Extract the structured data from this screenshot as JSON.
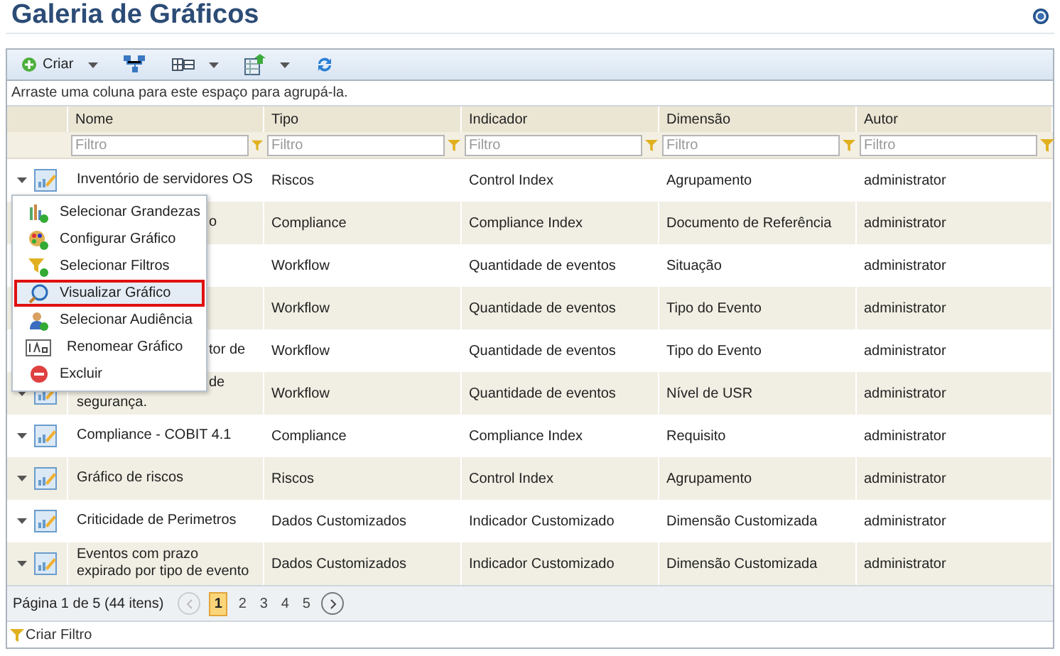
{
  "page": {
    "title": "Galeria de Gráficos"
  },
  "toolbar": [
    {
      "kind": "create",
      "label": "Criar",
      "dropdown": true
    },
    {
      "kind": "hierarchy",
      "dropdown": false
    },
    {
      "kind": "columns",
      "dropdown": true
    },
    {
      "kind": "export",
      "dropdown": true
    },
    {
      "kind": "refresh",
      "dropdown": false
    }
  ],
  "group_panel": {
    "text": "Arraste uma coluna para este espaço para agrupá-la."
  },
  "table": {
    "columns": [
      {
        "label": "Nome",
        "filter_placeholder": "Filtro"
      },
      {
        "label": "Tipo",
        "filter_placeholder": "Filtro"
      },
      {
        "label": "Indicador",
        "filter_placeholder": "Filtro"
      },
      {
        "label": "Dimensão",
        "filter_placeholder": "Filtro"
      },
      {
        "label": "Autor",
        "filter_placeholder": "Filtro"
      }
    ],
    "rows": [
      {
        "kind": "normal",
        "cells": [
          "Inventório de servidores OS",
          "Riscos",
          "Control Index",
          "Agrupamento",
          "administrator"
        ]
      },
      {
        "kind": "under_menu",
        "cells": [
          "o",
          "Compliance",
          "Compliance Index",
          "Documento de Referência",
          "administrator"
        ]
      },
      {
        "kind": "under_menu",
        "cells": [
          "",
          "Workflow",
          "Quantidade de eventos",
          "Situação",
          "administrator"
        ]
      },
      {
        "kind": "under_menu",
        "cells": [
          "",
          "Workflow",
          "Quantidade de eventos",
          "Tipo do Evento",
          "administrator"
        ]
      },
      {
        "kind": "under_menu",
        "cells": [
          "tor de",
          "Workflow",
          "Quantidade de eventos",
          "Tipo do Evento",
          "administrator"
        ]
      },
      {
        "kind": "partly_under_menu",
        "cells": [
          "de\nsegurança.",
          "Workflow",
          "Quantidade de eventos",
          "Nível de USR",
          "administrator"
        ]
      },
      {
        "kind": "normal",
        "cells": [
          "Compliance - COBIT 4.1",
          "Compliance",
          "Compliance Index",
          "Requisito",
          "administrator"
        ]
      },
      {
        "kind": "normal",
        "cells": [
          "Gráfico de riscos",
          "Riscos",
          "Control Index",
          "Agrupamento",
          "administrator"
        ]
      },
      {
        "kind": "normal",
        "cells": [
          "Criticidade de Perimetros",
          "Dados Customizados",
          "Indicador Customizado",
          "Dimensão Customizada",
          "administrator"
        ]
      },
      {
        "kind": "normal",
        "cells": [
          "Eventos com prazo expirado por tipo de evento",
          "Dados Customizados",
          "Indicador Customizado",
          "Dimensão Customizada",
          "administrator"
        ]
      }
    ]
  },
  "context_menu": {
    "items": [
      {
        "kind": "measures",
        "label": "Selecionar Grandezas",
        "selected": false
      },
      {
        "kind": "configure",
        "label": "Configurar Gráfico",
        "selected": false
      },
      {
        "kind": "filters",
        "label": "Selecionar Filtros",
        "selected": false
      },
      {
        "kind": "view",
        "label": "Visualizar Gráfico",
        "selected": true
      },
      {
        "kind": "audience",
        "label": "Selecionar Audiência",
        "selected": false
      },
      {
        "kind": "rename",
        "label": "Renomear Gráfico",
        "selected": false
      },
      {
        "kind": "delete",
        "label": "Excluir",
        "selected": false
      }
    ]
  },
  "pager": {
    "summary": "Página 1 de 5 (44 itens)",
    "pages": [
      {
        "label": "1",
        "selected": true
      },
      {
        "label": "2",
        "selected": false
      },
      {
        "label": "3",
        "selected": false
      },
      {
        "label": "4",
        "selected": false
      },
      {
        "label": "5",
        "selected": false
      }
    ]
  },
  "footer": {
    "link": "Criar Filtro"
  }
}
